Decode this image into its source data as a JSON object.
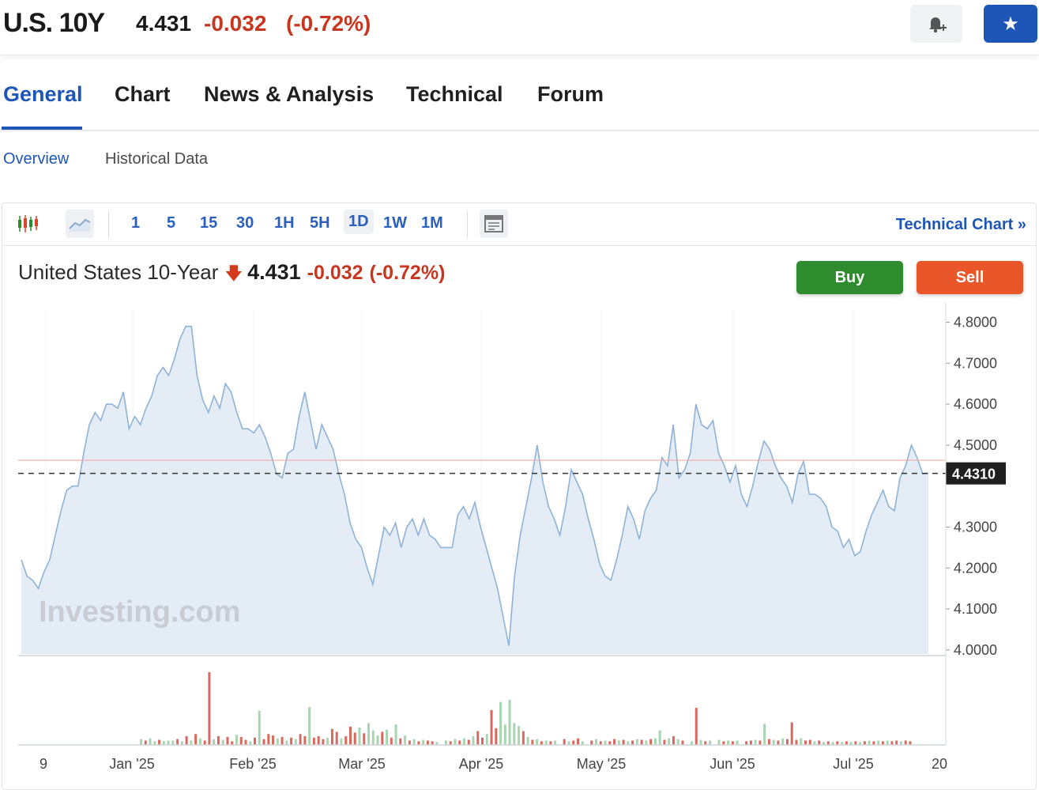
{
  "header": {
    "symbol": "U.S. 10Y",
    "price": "4.431",
    "change": "-0.032",
    "change_pct": "(-0.72%)",
    "alert_icon": "bell-plus-icon",
    "watchlist_icon": "star-icon"
  },
  "tabs": [
    {
      "label": "General",
      "active": true
    },
    {
      "label": "Chart"
    },
    {
      "label": "News & Analysis"
    },
    {
      "label": "Technical"
    },
    {
      "label": "Forum"
    }
  ],
  "subtabs": [
    {
      "label": "Overview",
      "active": true
    },
    {
      "label": "Historical Data"
    }
  ],
  "toolbar": {
    "chart_type_icons": [
      "candlestick-icon",
      "area-line-icon"
    ],
    "intervals": [
      "1",
      "5",
      "15",
      "30",
      "1H",
      "5H",
      "1D",
      "1W",
      "1M"
    ],
    "active_interval": "1D",
    "layout_icon": "layout-icon",
    "technical_link": "Technical Chart »"
  },
  "instrument": {
    "name": "United States 10-Year",
    "price": "4.431",
    "change": "-0.032",
    "change_pct": "(-0.72%)"
  },
  "actions": {
    "buy": "Buy",
    "sell": "Sell"
  },
  "watermark": "Investing.com",
  "colors": {
    "accent": "#1e56b8",
    "down": "#c7361f",
    "buy": "#2e8b2e",
    "sell": "#e8562a",
    "area_line": "#8fb2d8",
    "area_fill": "#e4edf5",
    "volume_up": "#a8d5b0",
    "volume_down": "#d9685e"
  },
  "chart_data": {
    "type": "area",
    "y_ticks": [
      "4.8000",
      "4.7000",
      "4.6000",
      "4.5000",
      "4.3000",
      "4.2000",
      "4.1000",
      "4.0000"
    ],
    "ylim": [
      3.99,
      4.83
    ],
    "x_ticks": [
      "9",
      "Jan '25",
      "Feb '25",
      "Mar '25",
      "Apr '25",
      "May '25",
      "Jun '25",
      "Jul '25",
      "20"
    ],
    "current_label": "4.4310",
    "current_value": 4.431,
    "reference_value": 4.463,
    "series": [
      {
        "values": [
          4.22,
          4.18,
          4.17,
          4.15,
          4.19,
          4.22,
          4.28,
          4.34,
          4.39,
          4.4,
          4.4,
          4.48,
          4.55,
          4.58,
          4.56,
          4.6,
          4.6,
          4.59,
          4.63,
          4.54,
          4.57,
          4.55,
          4.59,
          4.62,
          4.67,
          4.69,
          4.67,
          4.71,
          4.76,
          4.79,
          4.79,
          4.67,
          4.61,
          4.58,
          4.62,
          4.59,
          4.65,
          4.63,
          4.58,
          4.54,
          4.54,
          4.53,
          4.55,
          4.52,
          4.48,
          4.43,
          4.42,
          4.48,
          4.49,
          4.57,
          4.63,
          4.56,
          4.49,
          4.55,
          4.52,
          4.49,
          4.43,
          4.38,
          4.31,
          4.27,
          4.25,
          4.2,
          4.16,
          4.23,
          4.3,
          4.28,
          4.31,
          4.25,
          4.3,
          4.32,
          4.28,
          4.32,
          4.28,
          4.27,
          4.25,
          4.25,
          4.25,
          4.33,
          4.35,
          4.32,
          4.36,
          4.3,
          4.25,
          4.2,
          4.15,
          4.08,
          4.01,
          4.18,
          4.28,
          4.35,
          4.42,
          4.5,
          4.41,
          4.35,
          4.32,
          4.28,
          4.35,
          4.44,
          4.41,
          4.38,
          4.32,
          4.27,
          4.21,
          4.18,
          4.17,
          4.22,
          4.28,
          4.35,
          4.32,
          4.27,
          4.34,
          4.37,
          4.39,
          4.47,
          4.45,
          4.55,
          4.42,
          4.44,
          4.48,
          4.6,
          4.55,
          4.54,
          4.56,
          4.48,
          4.45,
          4.41,
          4.45,
          4.38,
          4.35,
          4.4,
          4.46,
          4.51,
          4.49,
          4.45,
          4.42,
          4.4,
          4.36,
          4.43,
          4.46,
          4.38,
          4.38,
          4.37,
          4.35,
          4.3,
          4.29,
          4.25,
          4.27,
          4.23,
          4.24,
          4.29,
          4.33,
          4.36,
          4.39,
          4.35,
          4.34,
          4.42,
          4.45,
          4.5,
          4.47,
          4.43,
          4.431
        ]
      }
    ],
    "volume": [
      {
        "x": 0.135,
        "h": 0.08,
        "up": true
      },
      {
        "x": 0.14,
        "h": 0.06,
        "up": false
      },
      {
        "x": 0.145,
        "h": 0.09,
        "up": true
      },
      {
        "x": 0.15,
        "h": 0.05,
        "up": true
      },
      {
        "x": 0.155,
        "h": 0.07,
        "up": false
      },
      {
        "x": 0.16,
        "h": 0.05,
        "up": true
      },
      {
        "x": 0.165,
        "h": 0.06,
        "up": true
      },
      {
        "x": 0.17,
        "h": 0.06,
        "up": true
      },
      {
        "x": 0.175,
        "h": 0.08,
        "up": false
      },
      {
        "x": 0.18,
        "h": 0.05,
        "up": true
      },
      {
        "x": 0.185,
        "h": 0.12,
        "up": false
      },
      {
        "x": 0.19,
        "h": 0.06,
        "up": true
      },
      {
        "x": 0.195,
        "h": 0.15,
        "up": false
      },
      {
        "x": 0.2,
        "h": 0.09,
        "up": true
      },
      {
        "x": 0.205,
        "h": 0.06,
        "up": false
      },
      {
        "x": 0.21,
        "h": 1.0,
        "up": false
      },
      {
        "x": 0.215,
        "h": 0.08,
        "up": true
      },
      {
        "x": 0.22,
        "h": 0.12,
        "up": false
      },
      {
        "x": 0.225,
        "h": 0.07,
        "up": true
      },
      {
        "x": 0.23,
        "h": 0.11,
        "up": false
      },
      {
        "x": 0.235,
        "h": 0.05,
        "up": false
      },
      {
        "x": 0.24,
        "h": 0.14,
        "up": true
      },
      {
        "x": 0.245,
        "h": 0.11,
        "up": false
      },
      {
        "x": 0.25,
        "h": 0.07,
        "up": false
      },
      {
        "x": 0.255,
        "h": 0.05,
        "up": true
      },
      {
        "x": 0.26,
        "h": 0.1,
        "up": false
      },
      {
        "x": 0.265,
        "h": 0.47,
        "up": true
      },
      {
        "x": 0.27,
        "h": 0.08,
        "up": false
      },
      {
        "x": 0.275,
        "h": 0.15,
        "up": false
      },
      {
        "x": 0.28,
        "h": 0.13,
        "up": false
      },
      {
        "x": 0.285,
        "h": 0.09,
        "up": true
      },
      {
        "x": 0.29,
        "h": 0.11,
        "up": false
      },
      {
        "x": 0.295,
        "h": 0.06,
        "up": true
      },
      {
        "x": 0.3,
        "h": 0.1,
        "up": false
      },
      {
        "x": 0.305,
        "h": 0.08,
        "up": true
      },
      {
        "x": 0.31,
        "h": 0.15,
        "up": false
      },
      {
        "x": 0.315,
        "h": 0.12,
        "up": false
      },
      {
        "x": 0.32,
        "h": 0.52,
        "up": true
      },
      {
        "x": 0.325,
        "h": 0.1,
        "up": false
      },
      {
        "x": 0.33,
        "h": 0.12,
        "up": false
      },
      {
        "x": 0.335,
        "h": 0.08,
        "up": false
      },
      {
        "x": 0.34,
        "h": 0.1,
        "up": true
      },
      {
        "x": 0.345,
        "h": 0.22,
        "up": false
      },
      {
        "x": 0.35,
        "h": 0.18,
        "up": false
      },
      {
        "x": 0.355,
        "h": 0.09,
        "up": true
      },
      {
        "x": 0.36,
        "h": 0.12,
        "up": false
      },
      {
        "x": 0.365,
        "h": 0.25,
        "up": false
      },
      {
        "x": 0.37,
        "h": 0.17,
        "up": false
      },
      {
        "x": 0.375,
        "h": 0.24,
        "up": true
      },
      {
        "x": 0.38,
        "h": 0.16,
        "up": false
      },
      {
        "x": 0.385,
        "h": 0.3,
        "up": true
      },
      {
        "x": 0.39,
        "h": 0.2,
        "up": true
      },
      {
        "x": 0.395,
        "h": 0.13,
        "up": true
      },
      {
        "x": 0.4,
        "h": 0.18,
        "up": false
      },
      {
        "x": 0.405,
        "h": 0.21,
        "up": true
      },
      {
        "x": 0.41,
        "h": 0.1,
        "up": false
      },
      {
        "x": 0.415,
        "h": 0.28,
        "up": true
      },
      {
        "x": 0.42,
        "h": 0.09,
        "up": false
      },
      {
        "x": 0.425,
        "h": 0.13,
        "up": true
      },
      {
        "x": 0.43,
        "h": 0.06,
        "up": false
      },
      {
        "x": 0.435,
        "h": 0.08,
        "up": true
      },
      {
        "x": 0.44,
        "h": 0.05,
        "up": false
      },
      {
        "x": 0.445,
        "h": 0.07,
        "up": true
      },
      {
        "x": 0.45,
        "h": 0.06,
        "up": false
      },
      {
        "x": 0.455,
        "h": 0.05,
        "up": false
      },
      {
        "x": 0.46,
        "h": 0.04,
        "up": true
      },
      {
        "x": 0.47,
        "h": 0.06,
        "up": true
      },
      {
        "x": 0.475,
        "h": 0.05,
        "up": false
      },
      {
        "x": 0.48,
        "h": 0.08,
        "up": true
      },
      {
        "x": 0.485,
        "h": 0.06,
        "up": false
      },
      {
        "x": 0.49,
        "h": 0.09,
        "up": true
      },
      {
        "x": 0.495,
        "h": 0.07,
        "up": false
      },
      {
        "x": 0.5,
        "h": 0.12,
        "up": true
      },
      {
        "x": 0.505,
        "h": 0.19,
        "up": false
      },
      {
        "x": 0.51,
        "h": 0.1,
        "up": false
      },
      {
        "x": 0.515,
        "h": 0.15,
        "up": true
      },
      {
        "x": 0.52,
        "h": 0.48,
        "up": false
      },
      {
        "x": 0.525,
        "h": 0.23,
        "up": false
      },
      {
        "x": 0.53,
        "h": 0.59,
        "up": true
      },
      {
        "x": 0.535,
        "h": 0.28,
        "up": true
      },
      {
        "x": 0.54,
        "h": 0.62,
        "up": true
      },
      {
        "x": 0.545,
        "h": 0.3,
        "up": true
      },
      {
        "x": 0.55,
        "h": 0.26,
        "up": true
      },
      {
        "x": 0.555,
        "h": 0.19,
        "up": false
      },
      {
        "x": 0.56,
        "h": 0.11,
        "up": true
      },
      {
        "x": 0.565,
        "h": 0.07,
        "up": false
      },
      {
        "x": 0.57,
        "h": 0.08,
        "up": true
      },
      {
        "x": 0.575,
        "h": 0.05,
        "up": false
      },
      {
        "x": 0.58,
        "h": 0.06,
        "up": true
      },
      {
        "x": 0.585,
        "h": 0.05,
        "up": false
      },
      {
        "x": 0.59,
        "h": 0.06,
        "up": true
      },
      {
        "x": 0.6,
        "h": 0.08,
        "up": false
      },
      {
        "x": 0.605,
        "h": 0.05,
        "up": true
      },
      {
        "x": 0.61,
        "h": 0.06,
        "up": false
      },
      {
        "x": 0.615,
        "h": 0.09,
        "up": false
      },
      {
        "x": 0.62,
        "h": 0.05,
        "up": true
      },
      {
        "x": 0.63,
        "h": 0.06,
        "up": false
      },
      {
        "x": 0.635,
        "h": 0.08,
        "up": true
      },
      {
        "x": 0.64,
        "h": 0.05,
        "up": false
      },
      {
        "x": 0.645,
        "h": 0.06,
        "up": true
      },
      {
        "x": 0.65,
        "h": 0.05,
        "up": false
      },
      {
        "x": 0.655,
        "h": 0.08,
        "up": false
      },
      {
        "x": 0.66,
        "h": 0.06,
        "up": true
      },
      {
        "x": 0.665,
        "h": 0.07,
        "up": false
      },
      {
        "x": 0.67,
        "h": 0.05,
        "up": true
      },
      {
        "x": 0.675,
        "h": 0.06,
        "up": false
      },
      {
        "x": 0.68,
        "h": 0.08,
        "up": true
      },
      {
        "x": 0.685,
        "h": 0.07,
        "up": false
      },
      {
        "x": 0.69,
        "h": 0.06,
        "up": true
      },
      {
        "x": 0.695,
        "h": 0.08,
        "up": false
      },
      {
        "x": 0.7,
        "h": 0.09,
        "up": true
      },
      {
        "x": 0.705,
        "h": 0.2,
        "up": true
      },
      {
        "x": 0.71,
        "h": 0.07,
        "up": false
      },
      {
        "x": 0.715,
        "h": 0.09,
        "up": true
      },
      {
        "x": 0.72,
        "h": 0.12,
        "up": false
      },
      {
        "x": 0.725,
        "h": 0.08,
        "up": true
      },
      {
        "x": 0.73,
        "h": 0.06,
        "up": false
      },
      {
        "x": 0.74,
        "h": 0.05,
        "up": true
      },
      {
        "x": 0.745,
        "h": 0.51,
        "up": false
      },
      {
        "x": 0.75,
        "h": 0.07,
        "up": true
      },
      {
        "x": 0.755,
        "h": 0.05,
        "up": false
      },
      {
        "x": 0.76,
        "h": 0.06,
        "up": true
      },
      {
        "x": 0.77,
        "h": 0.07,
        "up": true
      },
      {
        "x": 0.775,
        "h": 0.05,
        "up": false
      },
      {
        "x": 0.78,
        "h": 0.06,
        "up": true
      },
      {
        "x": 0.785,
        "h": 0.05,
        "up": false
      },
      {
        "x": 0.79,
        "h": 0.06,
        "up": true
      },
      {
        "x": 0.8,
        "h": 0.05,
        "up": false
      },
      {
        "x": 0.805,
        "h": 0.06,
        "up": false
      },
      {
        "x": 0.81,
        "h": 0.07,
        "up": true
      },
      {
        "x": 0.815,
        "h": 0.06,
        "up": false
      },
      {
        "x": 0.82,
        "h": 0.29,
        "up": true
      },
      {
        "x": 0.825,
        "h": 0.08,
        "up": false
      },
      {
        "x": 0.83,
        "h": 0.07,
        "up": true
      },
      {
        "x": 0.835,
        "h": 0.06,
        "up": false
      },
      {
        "x": 0.84,
        "h": 0.09,
        "up": true
      },
      {
        "x": 0.845,
        "h": 0.08,
        "up": false
      },
      {
        "x": 0.85,
        "h": 0.31,
        "up": false
      },
      {
        "x": 0.855,
        "h": 0.07,
        "up": false
      },
      {
        "x": 0.86,
        "h": 0.09,
        "up": true
      },
      {
        "x": 0.865,
        "h": 0.06,
        "up": false
      },
      {
        "x": 0.87,
        "h": 0.07,
        "up": false
      },
      {
        "x": 0.875,
        "h": 0.05,
        "up": true
      },
      {
        "x": 0.88,
        "h": 0.06,
        "up": false
      },
      {
        "x": 0.885,
        "h": 0.04,
        "up": true
      },
      {
        "x": 0.89,
        "h": 0.05,
        "up": false
      },
      {
        "x": 0.895,
        "h": 0.04,
        "up": true
      },
      {
        "x": 0.9,
        "h": 0.05,
        "up": false
      },
      {
        "x": 0.905,
        "h": 0.04,
        "up": true
      },
      {
        "x": 0.91,
        "h": 0.05,
        "up": false
      },
      {
        "x": 0.915,
        "h": 0.04,
        "up": true
      },
      {
        "x": 0.92,
        "h": 0.05,
        "up": false
      },
      {
        "x": 0.925,
        "h": 0.04,
        "up": true
      },
      {
        "x": 0.93,
        "h": 0.05,
        "up": false
      },
      {
        "x": 0.935,
        "h": 0.06,
        "up": true
      },
      {
        "x": 0.94,
        "h": 0.05,
        "up": false
      },
      {
        "x": 0.945,
        "h": 0.06,
        "up": true
      },
      {
        "x": 0.95,
        "h": 0.05,
        "up": false
      },
      {
        "x": 0.955,
        "h": 0.06,
        "up": true
      },
      {
        "x": 0.96,
        "h": 0.05,
        "up": false
      },
      {
        "x": 0.965,
        "h": 0.06,
        "up": false
      },
      {
        "x": 0.97,
        "h": 0.05,
        "up": true
      },
      {
        "x": 0.975,
        "h": 0.06,
        "up": false
      },
      {
        "x": 0.98,
        "h": 0.05,
        "up": false
      }
    ]
  }
}
